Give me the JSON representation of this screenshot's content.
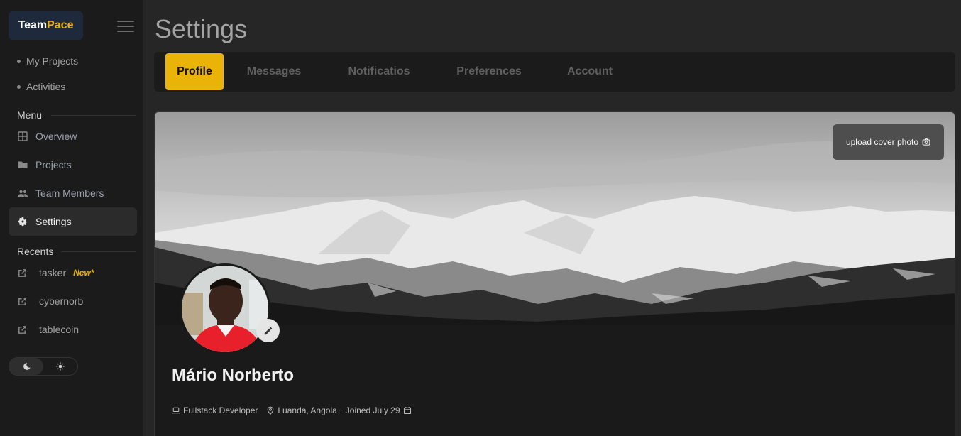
{
  "brand": {
    "part1": "Team",
    "part2": "Pace"
  },
  "top_links": [
    {
      "label": "My Projects"
    },
    {
      "label": "Activities"
    }
  ],
  "sections": {
    "menu": "Menu",
    "recents": "Recents"
  },
  "menu_items": [
    {
      "label": "Overview",
      "icon": "grid-icon"
    },
    {
      "label": "Projects",
      "icon": "folder-icon"
    },
    {
      "label": "Team Members",
      "icon": "people-icon"
    },
    {
      "label": "Settings",
      "icon": "gear-icon",
      "active": true
    }
  ],
  "recents": [
    {
      "label": "tasker",
      "badge": "New*"
    },
    {
      "label": "cybernorb"
    },
    {
      "label": "tablecoin"
    }
  ],
  "theme": {
    "active": "dark"
  },
  "page": {
    "title": "Settings"
  },
  "tabs": [
    {
      "label": "Profile",
      "active": true
    },
    {
      "label": "Messages"
    },
    {
      "label": "Notificatios"
    },
    {
      "label": "Preferences"
    },
    {
      "label": "Account"
    }
  ],
  "profile": {
    "upload_cover_label": "upload cover photo",
    "name": "Mário Norberto",
    "role": "Fullstack Developer",
    "location": "Luanda, Angola",
    "joined": "Joined July 29"
  },
  "colors": {
    "accent": "#eab308",
    "sidebar_bg": "#1b1b1b",
    "main_bg": "#262626"
  }
}
